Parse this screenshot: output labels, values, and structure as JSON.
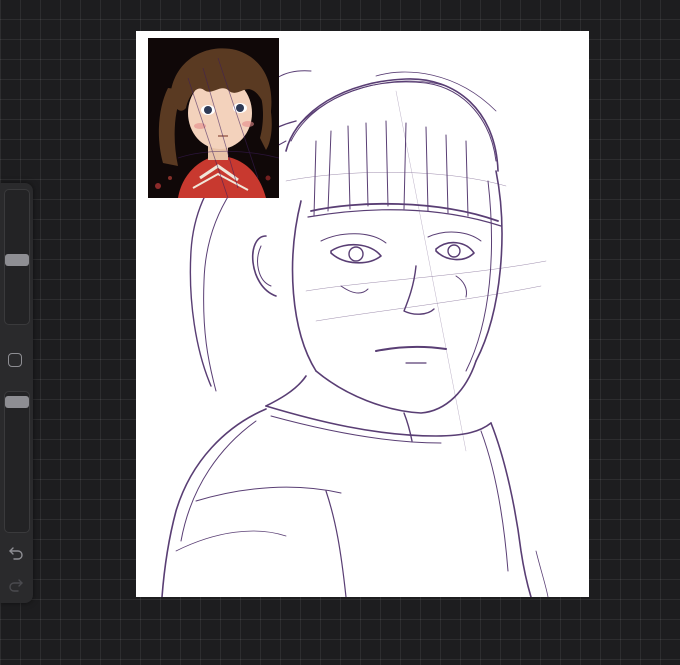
{
  "app": {
    "background_color": "#1d1d1f",
    "sketch_color": "#3d1d5c"
  },
  "sidebar": {
    "size_slider": {
      "icon": "brush-size-slider",
      "level": 0.55
    },
    "modify_button": {
      "icon": "square-icon"
    },
    "opacity_slider": {
      "icon": "opacity-slider",
      "level": 0.95
    },
    "undo": {
      "icon": "undo-icon"
    },
    "redo": {
      "icon": "redo-icon"
    }
  },
  "reference_image": {
    "description_icon": "reference-photo",
    "colors": {
      "hair": "#5a3a22",
      "skin": "#f3d2bc",
      "shirt": "#c8392f",
      "background": "#100808"
    }
  }
}
